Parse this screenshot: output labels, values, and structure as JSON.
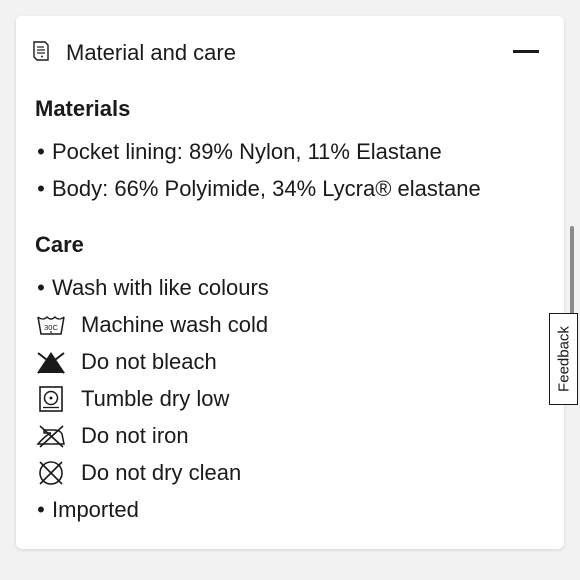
{
  "header": {
    "title": "Material and care",
    "icon": "document-icon",
    "toggle_icon": "minus-icon"
  },
  "materials": {
    "heading": "Materials",
    "items": [
      "Pocket lining: 89% Nylon, 11% Elastane",
      "Body: 66% Polyimide, 34% Lycra® elastane"
    ]
  },
  "care": {
    "heading": "Care",
    "first_item": "Wash with like colours",
    "instructions": [
      {
        "icon": "machine-wash-30c-icon",
        "icon_text": "30C",
        "label": "Machine wash cold"
      },
      {
        "icon": "do-not-bleach-icon",
        "label": "Do not bleach"
      },
      {
        "icon": "tumble-dry-low-icon",
        "label": "Tumble dry low"
      },
      {
        "icon": "do-not-iron-icon",
        "label": "Do not iron"
      },
      {
        "icon": "do-not-dry-clean-icon",
        "label": "Do not dry clean"
      }
    ],
    "last_item": "Imported"
  },
  "feedback": {
    "label": "Feedback"
  }
}
